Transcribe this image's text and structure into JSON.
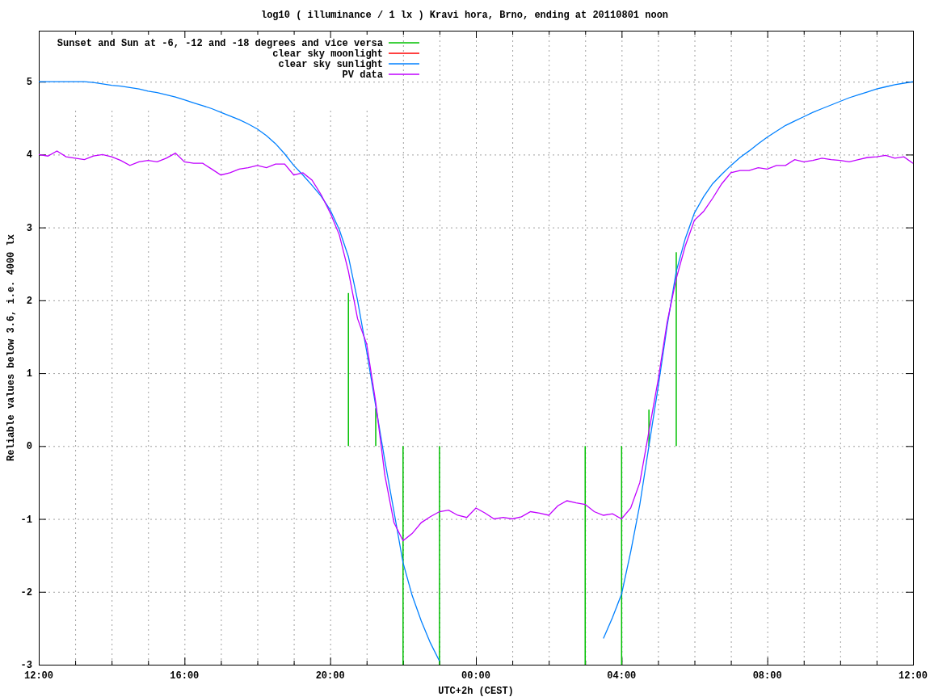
{
  "chart": {
    "chart_data": {
      "type": "line",
      "title": "log10 ( illuminance / 1 lx ) Kravi hora, Brno, ending at 20110801 noon",
      "xlabel": "UTC+2h (CEST)",
      "ylabel": "Reliable values below 3.6, i.e. 4000 lx",
      "categories": [
        "12:00",
        null,
        null,
        null,
        null,
        null,
        null,
        null,
        null,
        null,
        null,
        null,
        null,
        null,
        null,
        null,
        "16:00",
        null,
        null,
        null,
        null,
        null,
        null,
        null,
        null,
        null,
        null,
        null,
        null,
        null,
        null,
        null,
        "20:00",
        null,
        null,
        null,
        null,
        null,
        null,
        null,
        null,
        null,
        null,
        null,
        null,
        null,
        null,
        null,
        "00:00",
        null,
        null,
        null,
        null,
        null,
        null,
        null,
        null,
        null,
        null,
        null,
        null,
        null,
        null,
        null,
        "04:00",
        null,
        null,
        null,
        null,
        null,
        null,
        null,
        null,
        null,
        null,
        null,
        null,
        null,
        null,
        null,
        "08:00",
        null,
        null,
        null,
        null,
        null,
        null,
        null,
        null,
        null,
        null,
        null,
        null,
        null,
        null,
        null,
        "12:00"
      ],
      "ylim": [
        -3,
        5.7
      ],
      "yticks": [
        -3,
        -2,
        -1,
        0,
        1,
        2,
        3,
        4,
        5
      ],
      "grid": true,
      "legend": true,
      "series": [
        {
          "name": "Sunset and Sun at -6, -12 and -18 degrees and vice versa",
          "color": "#00c000",
          "type": "bar",
          "values": [
            null,
            null,
            null,
            null,
            null,
            null,
            null,
            null,
            null,
            null,
            null,
            null,
            null,
            null,
            null,
            null,
            null,
            null,
            null,
            null,
            null,
            null,
            null,
            null,
            null,
            null,
            null,
            null,
            null,
            null,
            null,
            null,
            null,
            null,
            2.1,
            null,
            null,
            0.52,
            null,
            null,
            -3,
            null,
            null,
            null,
            -3,
            null,
            null,
            null,
            null,
            null,
            null,
            null,
            null,
            null,
            null,
            null,
            null,
            null,
            null,
            null,
            -3,
            null,
            null,
            null,
            -3,
            null,
            null,
            0.5,
            null,
            null,
            2.66,
            null,
            null,
            null,
            null,
            null,
            null,
            null,
            null,
            null,
            null,
            null,
            null,
            null,
            null,
            null,
            null,
            null,
            null,
            null,
            null,
            null,
            null,
            null,
            null,
            null,
            null
          ]
        },
        {
          "name": "clear sky moonlight",
          "color": "#ff0000",
          "values": [
            null,
            null,
            null,
            null,
            null,
            null,
            null,
            null,
            null,
            null,
            null,
            null,
            null,
            null,
            null,
            null,
            null,
            null,
            null,
            null,
            null,
            null,
            null,
            null,
            null,
            null,
            null,
            null,
            null,
            null,
            null,
            null,
            null,
            null,
            null,
            null,
            null,
            null,
            null,
            null,
            null,
            null,
            null,
            null,
            null,
            null,
            null,
            null,
            null,
            null,
            null,
            null,
            null,
            null,
            null,
            null,
            null,
            null,
            null,
            null,
            null,
            null,
            null,
            null,
            null,
            null,
            null,
            null,
            null,
            null,
            null,
            null,
            null,
            null,
            null,
            null,
            null,
            null,
            null,
            null,
            null,
            null,
            null,
            null,
            null,
            null,
            null,
            null,
            null,
            null,
            null,
            null,
            null,
            null,
            null,
            null,
            null
          ]
        },
        {
          "name": "clear sky sunlight",
          "color": "#0080ff",
          "values": [
            5.0,
            5.0,
            5.0,
            5.0,
            5.0,
            5.0,
            4.99,
            4.97,
            4.95,
            4.94,
            4.92,
            4.9,
            4.87,
            4.85,
            4.82,
            4.79,
            4.75,
            4.71,
            4.67,
            4.63,
            4.58,
            4.53,
            4.48,
            4.42,
            4.35,
            4.26,
            4.15,
            4.01,
            3.85,
            3.72,
            3.58,
            3.43,
            3.24,
            2.97,
            2.6,
            2.0,
            1.3,
            0.55,
            -0.2,
            -0.9,
            -1.6,
            -2.05,
            -2.4,
            -2.7,
            -2.95,
            null,
            null,
            null,
            null,
            null,
            null,
            null,
            null,
            null,
            null,
            null,
            null,
            null,
            null,
            null,
            null,
            null,
            -2.64,
            -2.35,
            -2.03,
            -1.45,
            -0.8,
            0.0,
            0.8,
            1.65,
            2.4,
            2.85,
            3.2,
            3.42,
            3.6,
            3.73,
            3.85,
            3.96,
            4.05,
            4.15,
            4.24,
            4.32,
            4.4,
            4.46,
            4.52,
            4.58,
            4.63,
            4.68,
            4.73,
            4.78,
            4.82,
            4.86,
            4.9,
            4.93,
            4.96,
            4.98,
            5.0
          ]
        },
        {
          "name": "PV data",
          "color": "#c000ff",
          "values": [
            4.0,
            3.98,
            4.05,
            3.97,
            3.95,
            3.93,
            3.98,
            4.0,
            3.97,
            3.92,
            3.85,
            3.9,
            3.92,
            3.9,
            3.95,
            4.02,
            3.9,
            3.88,
            3.88,
            3.8,
            3.72,
            3.75,
            3.8,
            3.82,
            3.85,
            3.82,
            3.87,
            3.87,
            3.72,
            3.75,
            3.65,
            3.45,
            3.2,
            2.9,
            2.4,
            1.75,
            1.4,
            0.6,
            -0.4,
            -1.05,
            -1.3,
            -1.2,
            -1.05,
            -0.97,
            -0.9,
            -0.88,
            -0.95,
            -0.98,
            -0.85,
            -0.92,
            -1.0,
            -0.98,
            -1.0,
            -0.97,
            -0.9,
            -0.92,
            -0.95,
            -0.82,
            -0.75,
            -0.78,
            -0.8,
            -0.9,
            -0.95,
            -0.93,
            -1.0,
            -0.85,
            -0.5,
            0.2,
            0.9,
            1.7,
            2.3,
            2.75,
            3.1,
            3.22,
            3.4,
            3.6,
            3.75,
            3.78,
            3.78,
            3.82,
            3.8,
            3.85,
            3.85,
            3.93,
            3.9,
            3.92,
            3.95,
            3.93,
            3.92,
            3.9,
            3.93,
            3.96,
            3.97,
            3.99,
            3.95,
            3.97,
            3.88
          ]
        }
      ]
    }
  }
}
